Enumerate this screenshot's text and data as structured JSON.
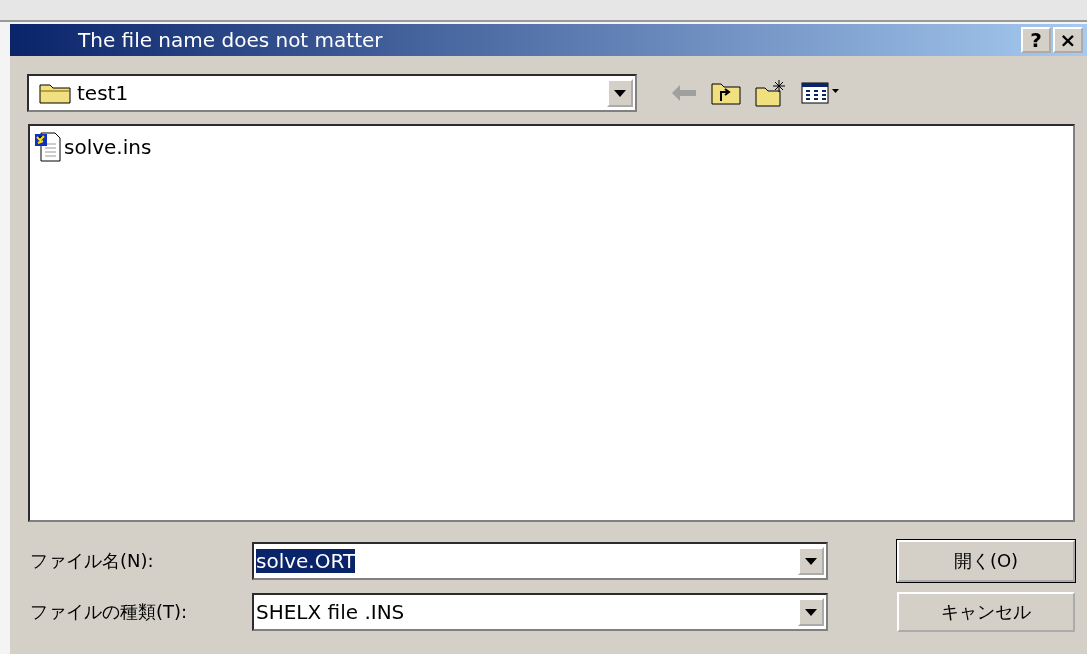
{
  "window": {
    "title": "The file name does not matter",
    "buttons": [
      "?",
      "×"
    ]
  },
  "location": {
    "value": "test1"
  },
  "files": [
    {
      "name": "solve.ins",
      "selected": false
    }
  ],
  "fields": [
    {
      "label": "ファイル名(N):",
      "value": "solve.ORT",
      "text_selected": true
    },
    {
      "label": "ファイルの種類(T):",
      "value": "SHELX file .INS",
      "text_selected": false
    }
  ],
  "buttons": [
    {
      "label": "開く(O)",
      "default": true
    },
    {
      "label": "キャンセル",
      "default": false
    }
  ]
}
